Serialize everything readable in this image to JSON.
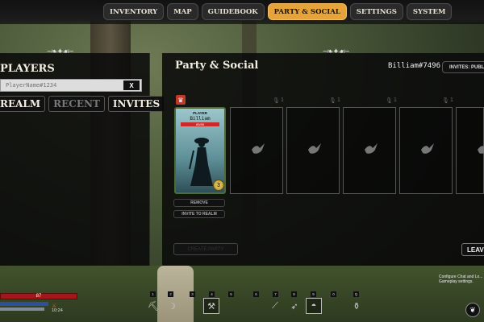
{
  "nav": {
    "tabs": [
      {
        "label": "INVENTORY"
      },
      {
        "label": "MAP"
      },
      {
        "label": "GUIDEBOOK"
      },
      {
        "label": "PARTY & SOCIAL",
        "active": true
      },
      {
        "label": "SETTINGS"
      },
      {
        "label": "SYSTEM"
      }
    ]
  },
  "players_panel": {
    "title": "PLAYERS",
    "search_placeholder": "PlayerName#1234",
    "search_clear": "X",
    "subtabs": [
      "REALM",
      "RECENT",
      "INVITES"
    ]
  },
  "party_panel": {
    "title": "Party & Social",
    "user_id": "Billiam#7496",
    "invites_button": "INVITES: PUBLIC",
    "player_card": {
      "label": "PLAYER",
      "name": "Billiam",
      "hp": "85/85",
      "level": "3"
    },
    "remove_button": "REMOVE",
    "invite_button": "INVITE TO REALM",
    "leave_button": "LEAVE",
    "create_party_button": "CREATE PARTY",
    "slot_voice_count": "1"
  },
  "hud": {
    "hp_value": "87",
    "time": "10:24",
    "hotbar_numbers": [
      "1",
      "2",
      "3",
      "4",
      "5",
      "6",
      "7",
      "8",
      "9",
      "0",
      "Q"
    ],
    "chat_hint": "Configure Chat and Lo... Gameplay settings."
  },
  "colors": {
    "accent": "#e6a33a",
    "panel": "#0a0a0a",
    "hp": "#a3161a"
  }
}
